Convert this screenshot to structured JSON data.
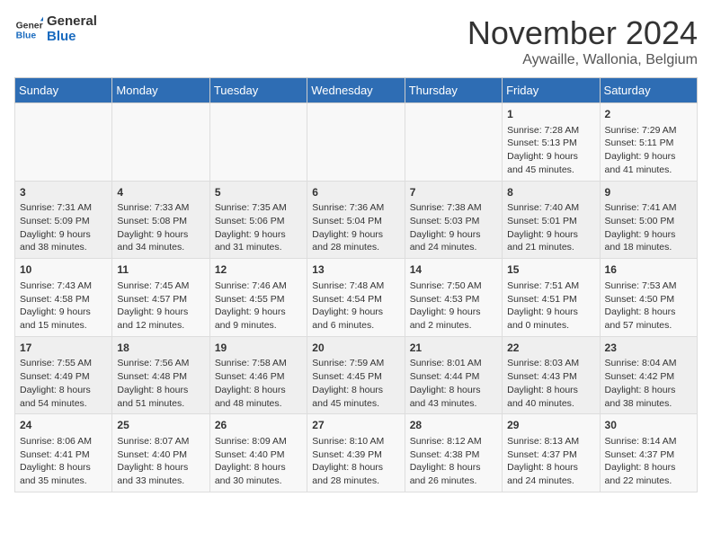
{
  "logo": {
    "line1": "General",
    "line2": "Blue"
  },
  "title": "November 2024",
  "location": "Aywaille, Wallonia, Belgium",
  "weekdays": [
    "Sunday",
    "Monday",
    "Tuesday",
    "Wednesday",
    "Thursday",
    "Friday",
    "Saturday"
  ],
  "weeks": [
    [
      {
        "day": "",
        "info": ""
      },
      {
        "day": "",
        "info": ""
      },
      {
        "day": "",
        "info": ""
      },
      {
        "day": "",
        "info": ""
      },
      {
        "day": "",
        "info": ""
      },
      {
        "day": "1",
        "info": "Sunrise: 7:28 AM\nSunset: 5:13 PM\nDaylight: 9 hours\nand 45 minutes."
      },
      {
        "day": "2",
        "info": "Sunrise: 7:29 AM\nSunset: 5:11 PM\nDaylight: 9 hours\nand 41 minutes."
      }
    ],
    [
      {
        "day": "3",
        "info": "Sunrise: 7:31 AM\nSunset: 5:09 PM\nDaylight: 9 hours\nand 38 minutes."
      },
      {
        "day": "4",
        "info": "Sunrise: 7:33 AM\nSunset: 5:08 PM\nDaylight: 9 hours\nand 34 minutes."
      },
      {
        "day": "5",
        "info": "Sunrise: 7:35 AM\nSunset: 5:06 PM\nDaylight: 9 hours\nand 31 minutes."
      },
      {
        "day": "6",
        "info": "Sunrise: 7:36 AM\nSunset: 5:04 PM\nDaylight: 9 hours\nand 28 minutes."
      },
      {
        "day": "7",
        "info": "Sunrise: 7:38 AM\nSunset: 5:03 PM\nDaylight: 9 hours\nand 24 minutes."
      },
      {
        "day": "8",
        "info": "Sunrise: 7:40 AM\nSunset: 5:01 PM\nDaylight: 9 hours\nand 21 minutes."
      },
      {
        "day": "9",
        "info": "Sunrise: 7:41 AM\nSunset: 5:00 PM\nDaylight: 9 hours\nand 18 minutes."
      }
    ],
    [
      {
        "day": "10",
        "info": "Sunrise: 7:43 AM\nSunset: 4:58 PM\nDaylight: 9 hours\nand 15 minutes."
      },
      {
        "day": "11",
        "info": "Sunrise: 7:45 AM\nSunset: 4:57 PM\nDaylight: 9 hours\nand 12 minutes."
      },
      {
        "day": "12",
        "info": "Sunrise: 7:46 AM\nSunset: 4:55 PM\nDaylight: 9 hours\nand 9 minutes."
      },
      {
        "day": "13",
        "info": "Sunrise: 7:48 AM\nSunset: 4:54 PM\nDaylight: 9 hours\nand 6 minutes."
      },
      {
        "day": "14",
        "info": "Sunrise: 7:50 AM\nSunset: 4:53 PM\nDaylight: 9 hours\nand 2 minutes."
      },
      {
        "day": "15",
        "info": "Sunrise: 7:51 AM\nSunset: 4:51 PM\nDaylight: 9 hours\nand 0 minutes."
      },
      {
        "day": "16",
        "info": "Sunrise: 7:53 AM\nSunset: 4:50 PM\nDaylight: 8 hours\nand 57 minutes."
      }
    ],
    [
      {
        "day": "17",
        "info": "Sunrise: 7:55 AM\nSunset: 4:49 PM\nDaylight: 8 hours\nand 54 minutes."
      },
      {
        "day": "18",
        "info": "Sunrise: 7:56 AM\nSunset: 4:48 PM\nDaylight: 8 hours\nand 51 minutes."
      },
      {
        "day": "19",
        "info": "Sunrise: 7:58 AM\nSunset: 4:46 PM\nDaylight: 8 hours\nand 48 minutes."
      },
      {
        "day": "20",
        "info": "Sunrise: 7:59 AM\nSunset: 4:45 PM\nDaylight: 8 hours\nand 45 minutes."
      },
      {
        "day": "21",
        "info": "Sunrise: 8:01 AM\nSunset: 4:44 PM\nDaylight: 8 hours\nand 43 minutes."
      },
      {
        "day": "22",
        "info": "Sunrise: 8:03 AM\nSunset: 4:43 PM\nDaylight: 8 hours\nand 40 minutes."
      },
      {
        "day": "23",
        "info": "Sunrise: 8:04 AM\nSunset: 4:42 PM\nDaylight: 8 hours\nand 38 minutes."
      }
    ],
    [
      {
        "day": "24",
        "info": "Sunrise: 8:06 AM\nSunset: 4:41 PM\nDaylight: 8 hours\nand 35 minutes."
      },
      {
        "day": "25",
        "info": "Sunrise: 8:07 AM\nSunset: 4:40 PM\nDaylight: 8 hours\nand 33 minutes."
      },
      {
        "day": "26",
        "info": "Sunrise: 8:09 AM\nSunset: 4:40 PM\nDaylight: 8 hours\nand 30 minutes."
      },
      {
        "day": "27",
        "info": "Sunrise: 8:10 AM\nSunset: 4:39 PM\nDaylight: 8 hours\nand 28 minutes."
      },
      {
        "day": "28",
        "info": "Sunrise: 8:12 AM\nSunset: 4:38 PM\nDaylight: 8 hours\nand 26 minutes."
      },
      {
        "day": "29",
        "info": "Sunrise: 8:13 AM\nSunset: 4:37 PM\nDaylight: 8 hours\nand 24 minutes."
      },
      {
        "day": "30",
        "info": "Sunrise: 8:14 AM\nSunset: 4:37 PM\nDaylight: 8 hours\nand 22 minutes."
      }
    ]
  ]
}
